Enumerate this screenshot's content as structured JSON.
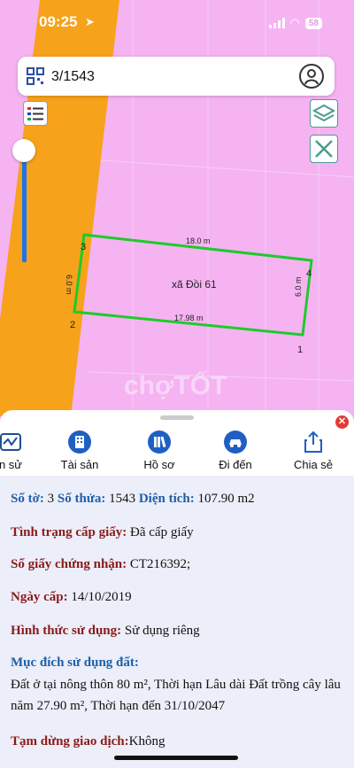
{
  "status_bar": {
    "time": "09:25",
    "battery": "58"
  },
  "search": {
    "value": "3/1543"
  },
  "map": {
    "parcel_label": "xã Đồi 61",
    "top_edge": "18.0 m",
    "bottom_edge": "17.98 m",
    "left_edge": "6.0 m",
    "right_edge": "6.0 m",
    "corners": [
      "1",
      "2",
      "3",
      "4"
    ],
    "watermark": "chợTỐT"
  },
  "tabs": [
    {
      "label": "n sử",
      "icon": "history-chart-icon"
    },
    {
      "label": "Tài sản",
      "icon": "building-icon"
    },
    {
      "label": "Hồ sơ",
      "icon": "books-icon"
    },
    {
      "label": "Đi đến",
      "icon": "car-icon"
    },
    {
      "label": "Chia sẻ",
      "icon": "share-icon"
    }
  ],
  "info": {
    "so_to_label": "Số tờ:",
    "so_to": "3",
    "so_thua_label": "Số thửa:",
    "so_thua": "1543",
    "dien_tich_label": "Diện tích:",
    "dien_tich": "107.90 m2",
    "tinh_trang_label": "Tình trạng cấp giấy:",
    "tinh_trang": "Đã cấp giấy",
    "so_giay_label": "Số giấy chứng nhận:",
    "so_giay": "CT216392;",
    "ngay_cap_label": "Ngày cấp:",
    "ngay_cap": "14/10/2019",
    "hinh_thuc_label": "Hình thức sử dụng:",
    "hinh_thuc": "Sử dụng riêng",
    "muc_dich_label": "Mục đích sử dụng đất:",
    "muc_dich": "Đất ở tại nông thôn 80 m², Thời hạn Lâu dài Đất trồng cây lâu năm 27.90 m², Thời hạn đến 31/10/2047",
    "tam_dung_label": "Tạm dừng giao dịch:",
    "tam_dung": "Không"
  },
  "colors": {
    "road": "#f7a21b",
    "parcel_border": "#1ecb2a",
    "land": "#f5b3f2"
  }
}
